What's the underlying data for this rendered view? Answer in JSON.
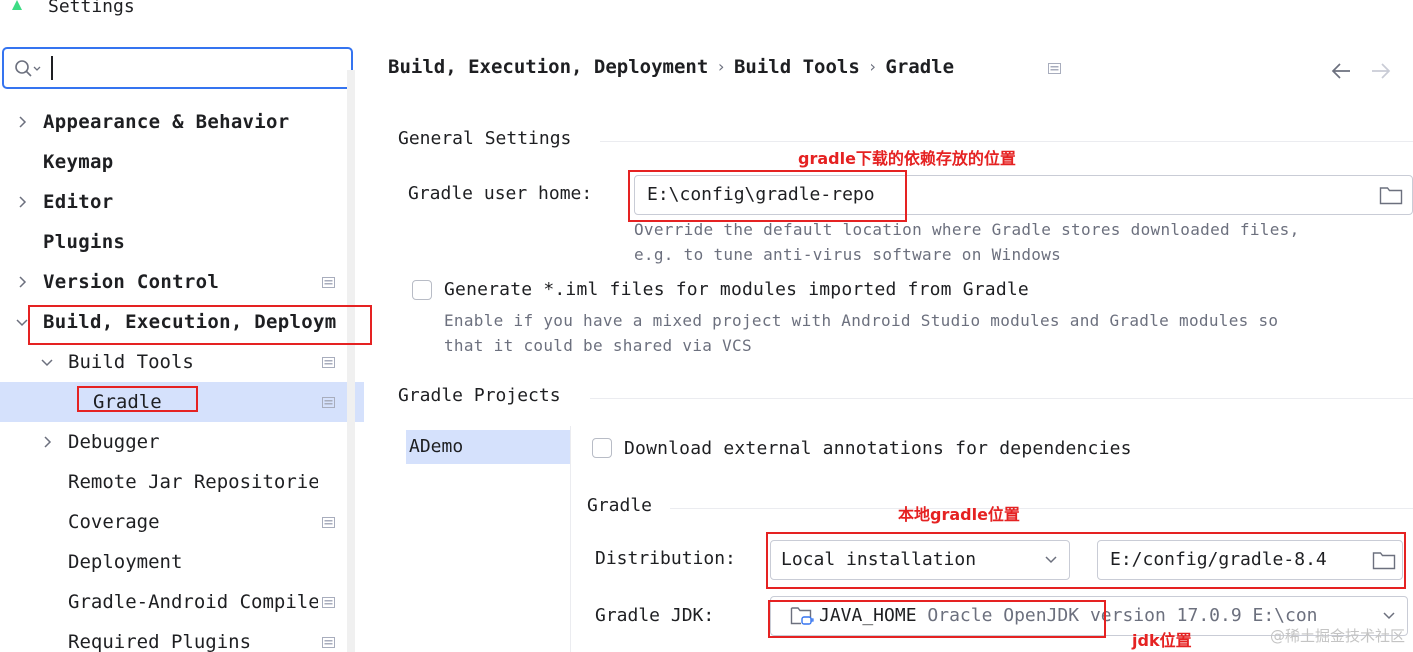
{
  "window": {
    "title": "Settings"
  },
  "search": {
    "value": "",
    "placeholder": ""
  },
  "sidebar": {
    "items": [
      {
        "label": "Appearance & Behavior",
        "bold": true,
        "chevron": "right"
      },
      {
        "label": "Keymap",
        "bold": true
      },
      {
        "label": "Editor",
        "bold": true,
        "chevron": "right"
      },
      {
        "label": "Plugins",
        "bold": true
      },
      {
        "label": "Version Control",
        "bold": true,
        "chevron": "right",
        "project_icon": true
      },
      {
        "label": "Build, Execution, Deployment",
        "bold": true,
        "chevron": "down"
      },
      {
        "label": "Build Tools",
        "chevron": "down",
        "project_icon": true
      },
      {
        "label": "Gradle",
        "selected": true,
        "project_icon": true
      },
      {
        "label": "Debugger",
        "chevron": "right"
      },
      {
        "label": "Remote Jar Repositories"
      },
      {
        "label": "Coverage",
        "project_icon": true
      },
      {
        "label": "Deployment"
      },
      {
        "label": "Gradle-Android Compiler",
        "project_icon": true
      },
      {
        "label": "Required Plugins",
        "project_icon": true
      }
    ]
  },
  "breadcrumb": [
    "Build, Execution, Deployment",
    "Build Tools",
    "Gradle"
  ],
  "breadcrumb_separator": "›",
  "general": {
    "title": "General Settings",
    "gradle_home_label": "Gradle user home:",
    "gradle_home_value": "E:\\config\\gradle-repo",
    "gradle_home_hint_1": "Override the default location where Gradle stores downloaded files,",
    "gradle_home_hint_2": "e.g. to tune anti-virus software on Windows",
    "iml_label": "Generate *.iml files for modules imported from Gradle",
    "iml_checked": false,
    "iml_hint_1": "Enable if you have a mixed project with Android Studio modules and Gradle modules so",
    "iml_hint_2": "that it could be shared via VCS"
  },
  "projects": {
    "title": "Gradle Projects",
    "list": [
      "ADemo"
    ],
    "download_annotations_label": "Download external annotations for dependencies",
    "download_annotations_checked": false,
    "gradle_subtitle": "Gradle",
    "distribution_label": "Distribution:",
    "distribution_value": "Local installation",
    "distribution_path": "E:/config/gradle-8.4",
    "jdk_label": "Gradle JDK:",
    "jdk_name": "JAVA_HOME",
    "jdk_detail": "Oracle OpenJDK version 17.0.9 E:\\con"
  },
  "annotations": {
    "gradle_repo": "gradle下载的依赖存放的位置",
    "local_gradle": "本地gradle位置",
    "jdk": "jdk位置"
  },
  "colors": {
    "accent": "#3574f0",
    "selection": "#d5e1fc",
    "annotation": "#e52222",
    "hint": "#6c707e"
  },
  "watermark": "@稀土掘金技术社区"
}
